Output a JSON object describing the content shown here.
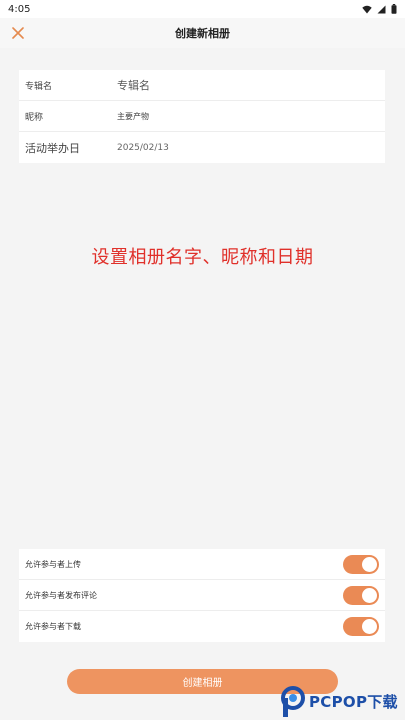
{
  "status_bar": {
    "time": "4:05",
    "icons": [
      "wifi-icon",
      "signal-icon",
      "battery-icon"
    ]
  },
  "header": {
    "title": "创建新相册",
    "close_icon": "close-icon"
  },
  "form": {
    "rows": [
      {
        "label": "专辑名",
        "value": "专辑名"
      },
      {
        "label": "昵称",
        "value": "主要产物"
      },
      {
        "label": "活动举办日",
        "value": "2025/02/13"
      }
    ]
  },
  "caption": "设置相册名字、昵称和日期",
  "toggles": [
    {
      "label": "允许参与者上传",
      "on": true
    },
    {
      "label": "允许参与者发布评论",
      "on": true
    },
    {
      "label": "允许参与者下载",
      "on": true
    }
  ],
  "create_button": "创建相册",
  "watermark": {
    "text": "PCPOP下载"
  },
  "colors": {
    "accent": "#ee9460",
    "toggle": "#ea8a55",
    "caption": "#e0302a",
    "watermark": "#1d4fa8"
  }
}
